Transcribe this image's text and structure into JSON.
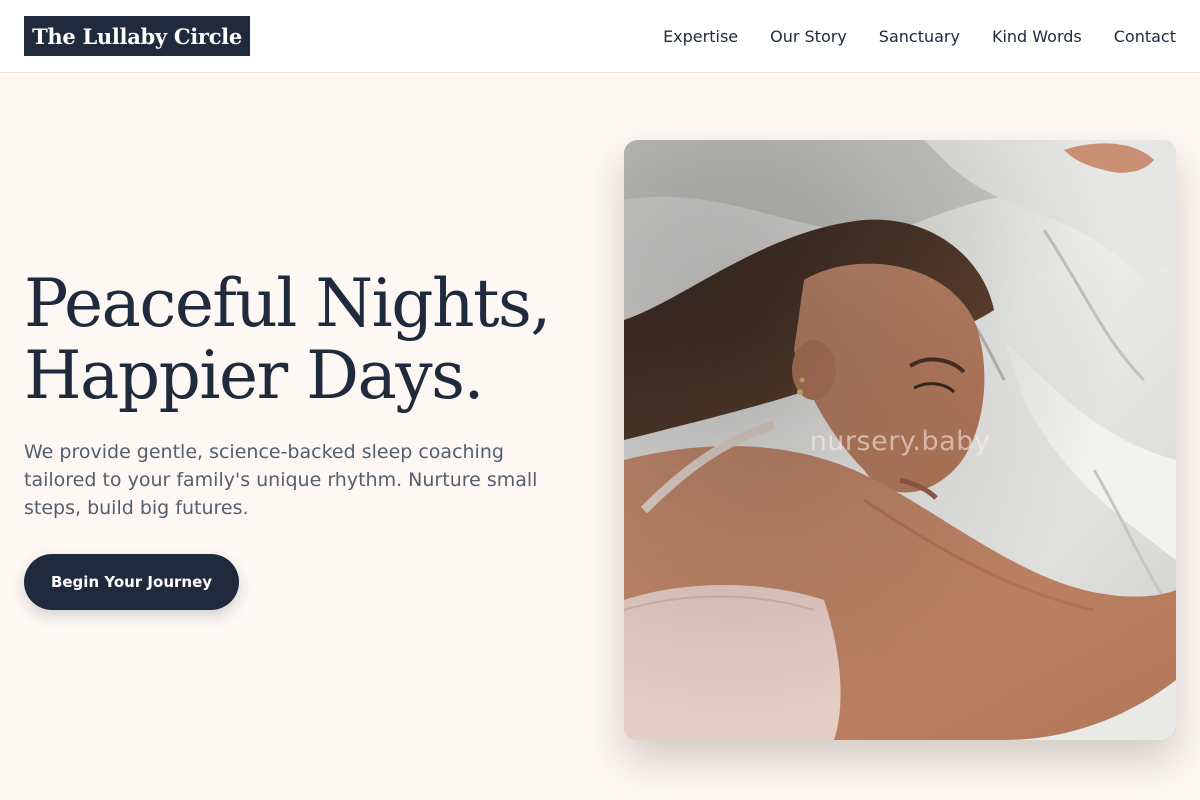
{
  "brand": {
    "logo_text": "The Lullaby Circle"
  },
  "nav": {
    "items": [
      {
        "label": "Expertise"
      },
      {
        "label": "Our Story"
      },
      {
        "label": "Sanctuary"
      },
      {
        "label": "Kind Words"
      },
      {
        "label": "Contact"
      }
    ]
  },
  "hero": {
    "headline_line1": "Peaceful Nights,",
    "headline_line2": "Happier Days.",
    "subtext": "We provide gentle, science-backed sleep coaching tailored to your family's unique rhythm. Nurture small steps, build big futures.",
    "cta_label": "Begin Your Journey",
    "image_watermark": "nursery.baby"
  },
  "colors": {
    "page_background": "#fdf8f4",
    "navy": "#1f2a3d",
    "body_text": "#545e6d"
  }
}
